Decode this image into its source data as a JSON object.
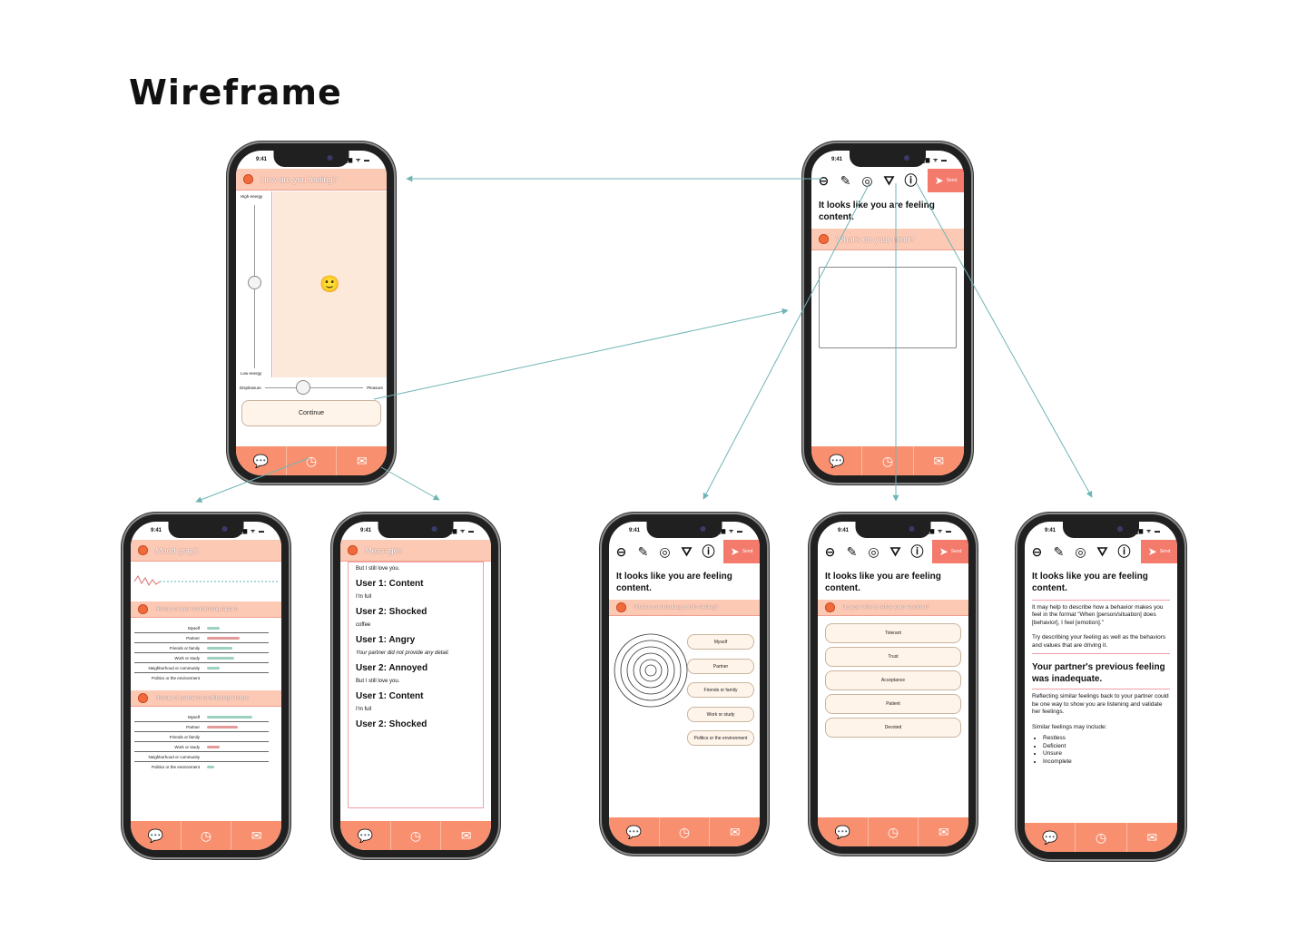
{
  "title": "Wireframe",
  "status_time": "9:41",
  "status_icons": "▂▄▆ ᯤ ▬",
  "icons": {
    "logo": "peach-logo-icon",
    "chat": "💬",
    "clock": "◷",
    "mail": "✉",
    "back": "⊖",
    "note": "✎",
    "target": "◎",
    "filter": "⛛",
    "info": "ⓘ",
    "plane": "➤",
    "face": "🙂"
  },
  "colors": {
    "header": "#fcc9b5",
    "tabbar": "#f89070",
    "send": "#f47a6c",
    "arrow": "#6fb5b5"
  },
  "mood": {
    "header": "How are you feeling?",
    "high_energy": "High energy",
    "low_energy": "Low energy",
    "displeasure": "Displeasure",
    "pleasure": "Pleasure",
    "continue": "Continue"
  },
  "journal": {
    "send": "Send",
    "feeling": "It looks like you are feeling content.",
    "prompt": "What's on your mind?"
  },
  "graph": {
    "header": "Mood graph",
    "history_header": "History of your contributing factors",
    "partner_header": "History of partner's contributing factors",
    "factors": [
      "Myself",
      "Partner",
      "Friends or family",
      "Work or study",
      "Neighborhood or community",
      "Politics or the environment"
    ]
  },
  "messages": {
    "header": "Messages",
    "top_line": "But I still love you.",
    "items": [
      {
        "user": "User 1: Content",
        "note": "I'm full"
      },
      {
        "user": "User 2: Shocked",
        "note": "coffee"
      },
      {
        "user": "User 1: Angry",
        "note": "Your partner did not provide any detail."
      },
      {
        "user": "User 2: Annoyed",
        "note": "But I still love you."
      },
      {
        "user": "User 1: Content",
        "note": "I'm full"
      },
      {
        "user": "User 2: Shocked",
        "note": ""
      }
    ]
  },
  "factors_screen": {
    "prompt": "What is contributing to this feeling?",
    "options": [
      "Myself",
      "Partner",
      "Friends or family",
      "Work or study",
      "Politics or the environment"
    ]
  },
  "refine_screen": {
    "prompt": "Do you wish to refine your emotion?",
    "options": [
      "Tolerant",
      "Trust",
      "Acceptance",
      "Patient",
      "Devoted"
    ]
  },
  "info_screen": {
    "hint1": "It may help to describe how a behavior makes you feel in the format \"When [person/situation] does [behavior], I feel [emotion].\"",
    "hint2": "Try describing your feeling as well as the behaviors and values that are driving it.",
    "partner_title": "Your partner's previous feeling was inadequate.",
    "hint3": "Reflecting similar feelings back to your partner could be one way to show you are listening and validate her feelings.",
    "similar": "Similar feelings may include:",
    "list": [
      "Restless",
      "Deficient",
      "Unsure",
      "Incomplete"
    ]
  }
}
